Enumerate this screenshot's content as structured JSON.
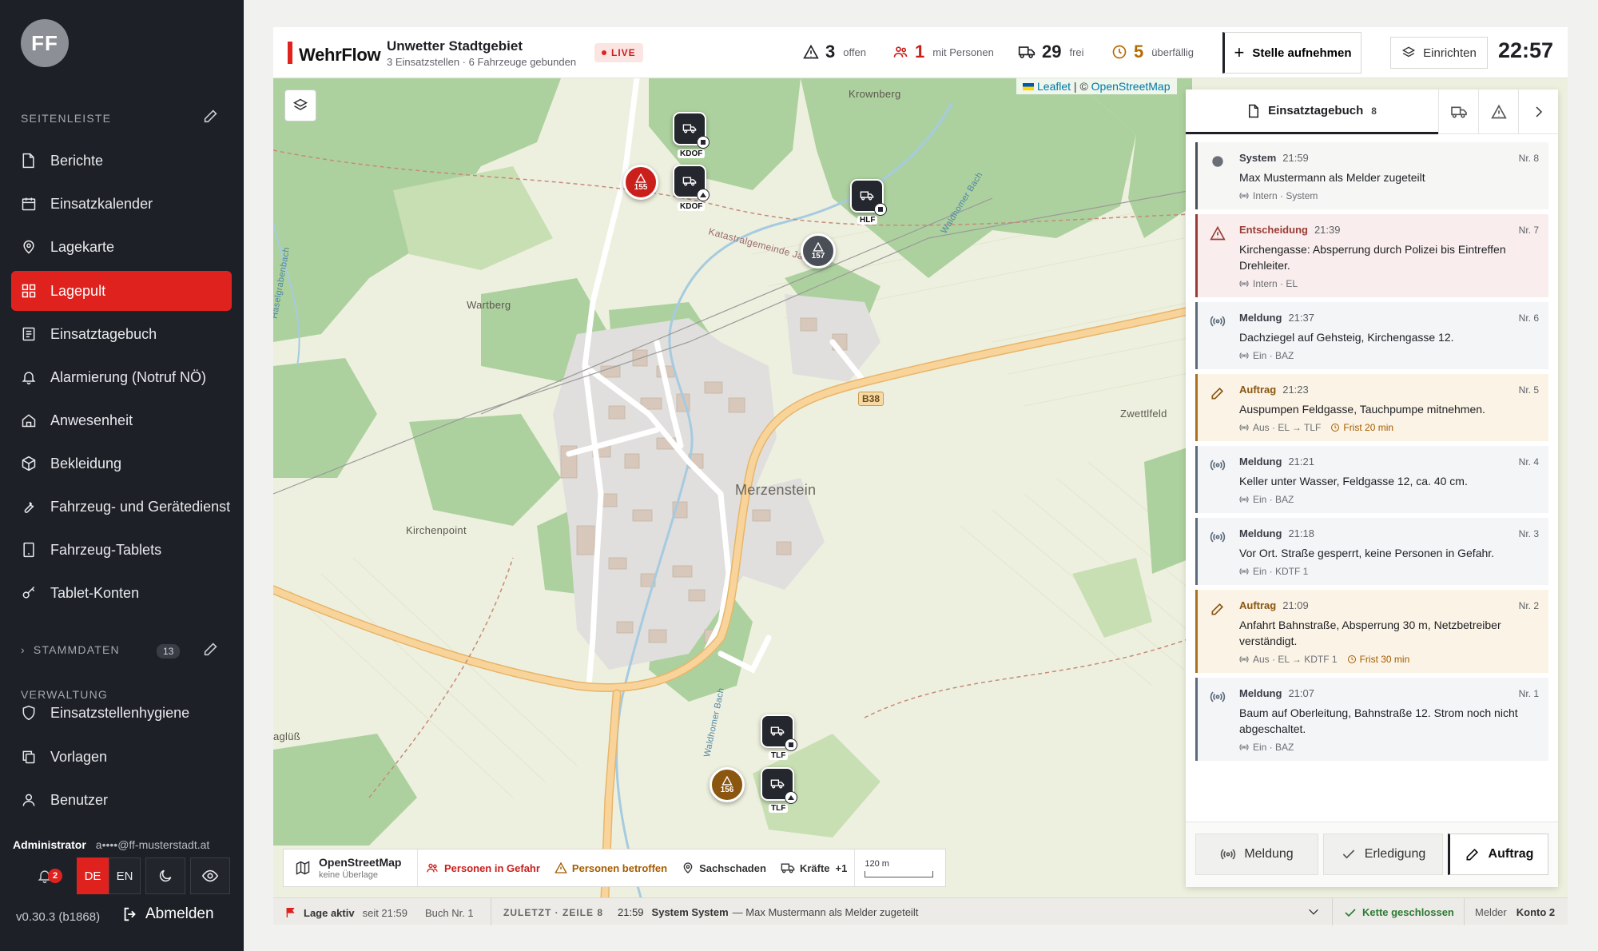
{
  "sidebar": {
    "avatar_initials": "FF",
    "section_sidebar": "SEITENLEISTE",
    "items": [
      {
        "label": "Berichte",
        "icon": "file-icon"
      },
      {
        "label": "Einsatzkalender",
        "icon": "calendar-icon"
      },
      {
        "label": "Lagekarte",
        "icon": "map-pin-icon"
      },
      {
        "label": "Lagepult",
        "icon": "grid-icon",
        "active": true
      },
      {
        "label": "Einsatztagebuch",
        "icon": "logbook-icon"
      },
      {
        "label": "Alarmierung (Notruf NÖ)",
        "icon": "bell-icon"
      },
      {
        "label": "Anwesenheit",
        "icon": "home-icon"
      },
      {
        "label": "Bekleidung",
        "icon": "box-icon"
      },
      {
        "label": "Fahrzeug- und Gerätedienst",
        "icon": "wrench-icon"
      },
      {
        "label": "Fahrzeug-Tablets",
        "icon": "tablet-icon"
      },
      {
        "label": "Tablet-Konten",
        "icon": "key-icon"
      }
    ],
    "stammdaten_label": "STAMMDATEN",
    "stammdaten_count": "13",
    "section_verwaltung": "VERWALTUNG",
    "admin_items": [
      {
        "label": "Einsatzstellenhygiene",
        "icon": "shield-icon"
      },
      {
        "label": "Vorlagen",
        "icon": "copy-icon"
      },
      {
        "label": "Benutzer",
        "icon": "user-icon"
      }
    ],
    "role": "Administrator",
    "email": "a••••@ff-musterstadt.at",
    "notif_count": "2",
    "lang_de": "DE",
    "lang_en": "EN",
    "version": "v0.30.3 (b1868)",
    "logout": "Abmelden"
  },
  "header": {
    "brand": "WehrFlow",
    "title": "Unwetter Stadtgebiet",
    "subtitle": "3 Einsatzstellen · 6 Fahrzeuge gebunden",
    "live": "LIVE",
    "stats": {
      "offen_num": "3",
      "offen_label": "offen",
      "personen_num": "1",
      "personen_label": "mit Personen",
      "frei_num": "29",
      "frei_label": "frei",
      "ueber_num": "5",
      "ueber_label": "überfällig"
    },
    "btn_stelle": "Stelle aufnehmen",
    "btn_einrichten": "Einrichten",
    "clock": "22:57"
  },
  "map": {
    "attrib_leaflet": "Leaflet",
    "attrib_sep": " | © ",
    "attrib_osm": "OpenStreetMap",
    "places": {
      "krownberg": "Krownberg",
      "wartberg": "Wartberg",
      "merzenstein": "Merzenstein",
      "zwettlfeld": "Zwettlfeld",
      "kirchenpoint": "Kirchenpoint",
      "katastral": "Katastralgemeinde Ja",
      "bach": "Waldhomer Bach",
      "bach2": "Waldhomer Bach",
      "left_edge": "aglüß",
      "bach_left": "Haselgrabenbach"
    },
    "road": "B38",
    "markers": {
      "kdof1": "KDOF",
      "kdof2": "KDOF",
      "hlf": "HLF",
      "tlf1": "TLF",
      "tlf2": "TLF",
      "inc155": "155",
      "inc157": "157",
      "inc156": "156"
    }
  },
  "legend": {
    "osm_title": "OpenStreetMap",
    "osm_sub": "keine Überlage",
    "gefahr": "Personen in Gefahr",
    "betroffen": "Personen betroffen",
    "sach": "Sachschaden",
    "kraefte": "Kräfte",
    "kraefte_plus": "+1",
    "scale": "120 m"
  },
  "panel": {
    "tab_title": "Einsatztagebuch",
    "tab_count": "8",
    "entries": [
      {
        "type": "System",
        "time": "21:59",
        "nr": "Nr. 8",
        "text": "Max Mustermann als Melder zugeteilt",
        "meta": "Intern · System",
        "frist": ""
      },
      {
        "type": "Entscheidung",
        "time": "21:39",
        "nr": "Nr. 7",
        "text": "Kirchengasse: Absperrung durch Polizei bis Eintreffen Drehleiter.",
        "meta": "Intern · EL",
        "frist": ""
      },
      {
        "type": "Meldung",
        "time": "21:37",
        "nr": "Nr. 6",
        "text": "Dachziegel auf Gehsteig, Kirchengasse 12.",
        "meta": "Ein · BAZ",
        "frist": ""
      },
      {
        "type": "Auftrag",
        "time": "21:23",
        "nr": "Nr. 5",
        "text": "Auspumpen Feldgasse, Tauchpumpe mitnehmen.",
        "meta": "Aus · EL → TLF",
        "frist": "Frist 20 min"
      },
      {
        "type": "Meldung",
        "time": "21:21",
        "nr": "Nr. 4",
        "text": "Keller unter Wasser, Feldgasse 12, ca. 40 cm.",
        "meta": "Ein · BAZ",
        "frist": ""
      },
      {
        "type": "Meldung",
        "time": "21:18",
        "nr": "Nr. 3",
        "text": "Vor Ort. Straße gesperrt, keine Personen in Gefahr.",
        "meta": "Ein · KDTF 1",
        "frist": ""
      },
      {
        "type": "Auftrag",
        "time": "21:09",
        "nr": "Nr. 2",
        "text": "Anfahrt Bahnstraße, Absperrung 30 m, Netzbetreiber verständigt.",
        "meta": "Aus · EL → KDTF 1",
        "frist": "Frist 30 min"
      },
      {
        "type": "Meldung",
        "time": "21:07",
        "nr": "Nr. 1",
        "text": "Baum auf Oberleitung, Bahnstraße 12. Strom noch nicht abgeschaltet.",
        "meta": "Ein · BAZ",
        "frist": ""
      }
    ],
    "btn_meldung": "Meldung",
    "btn_erledigung": "Erledigung",
    "btn_auftrag": "Auftrag"
  },
  "statusbar": {
    "lage": "Lage aktiv",
    "seit": "seit 21:59",
    "buch": "Buch Nr. 1",
    "zuletzt": "ZULETZT · ZEILE 8",
    "z_time": "21:59",
    "z_type": "System System",
    "z_text": "— Max Mustermann als Melder zugeteilt",
    "kette": "Kette geschlossen",
    "melder": "Melder",
    "konto": "Konto 2"
  }
}
